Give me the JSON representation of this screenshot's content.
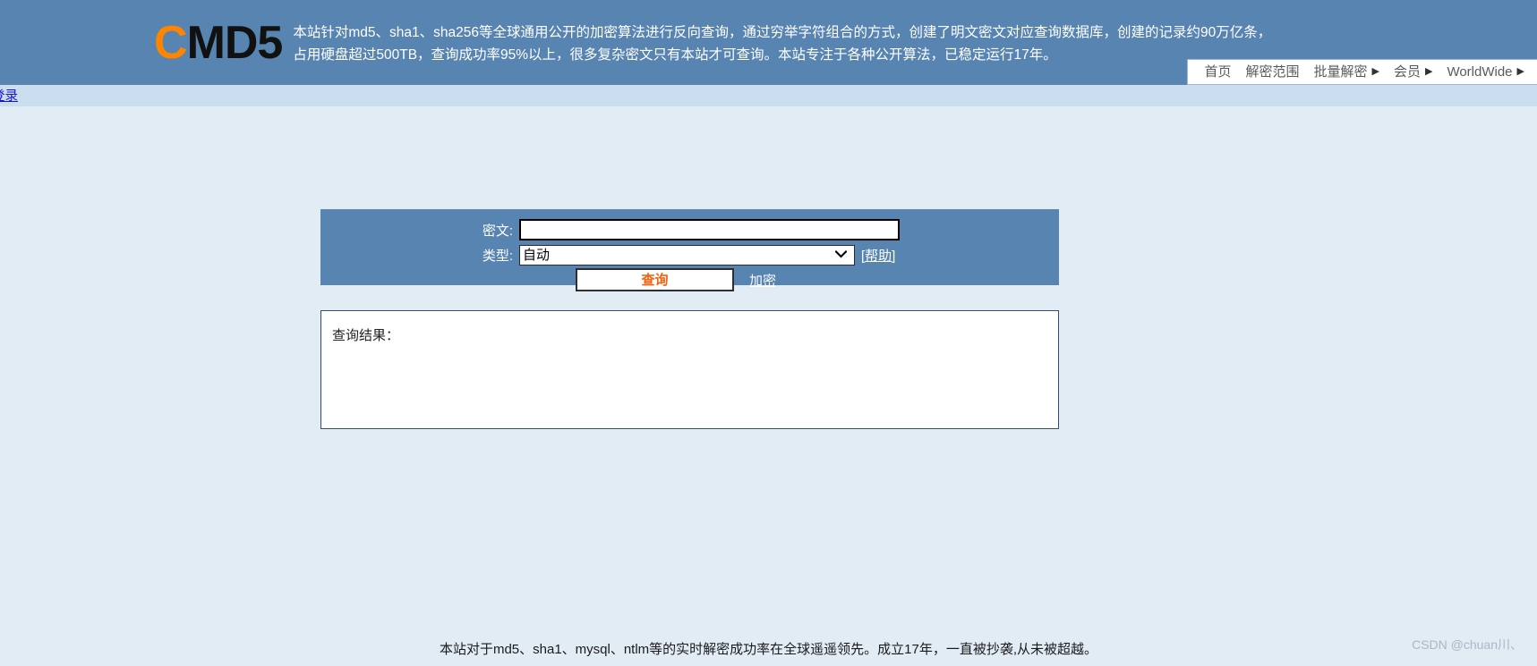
{
  "header": {
    "logo_c": "C",
    "logo_rest": "MD5",
    "description_line1": "本站针对md5、sha1、sha256等全球通用公开的加密算法进行反向查询，通过穷举字符组合的方式，创建了明文密文对应查询数据库，创建的记录约90万亿条，",
    "description_line2": "占用硬盘超过500TB，查询成功率95%以上，很多复杂密文只有本站才可查询。本站专注于各种公开算法，已稳定运行17年。",
    "colors": {
      "header_bg": "#5884b1",
      "logo_accent": "#ff8400",
      "subbar_bg": "#cbdeef",
      "body_bg": "#e1ecf5"
    }
  },
  "nav": {
    "items": [
      {
        "label": "首页",
        "has_arrow": false
      },
      {
        "label": "解密范围",
        "has_arrow": false
      },
      {
        "label": "批量解密",
        "has_arrow": true,
        "arrow": "▶"
      },
      {
        "label": "会员",
        "has_arrow": true,
        "arrow": "▶"
      },
      {
        "label": "WorldWide",
        "has_arrow": true,
        "arrow": "▶"
      }
    ]
  },
  "subbar": {
    "login_label": "登录"
  },
  "form": {
    "ciphertext_label": "密文:",
    "ciphertext_value": "",
    "ciphertext_placeholder": "",
    "type_label": "类型:",
    "type_selected": "自动",
    "type_options": [
      "自动"
    ],
    "select_arrow": "⌄",
    "help_label": "[帮助]",
    "query_button": "查询",
    "encrypt_link": "加密",
    "query_button_color": "#f4610f"
  },
  "result": {
    "label": "查询结果："
  },
  "footer": {
    "note": "本站对于md5、sha1、mysql、ntlm等的实时解密成功率在全球遥遥领先。成立17年，一直被抄袭,从未被超越。"
  },
  "watermark": {
    "text": "CSDN @chuan川、"
  }
}
